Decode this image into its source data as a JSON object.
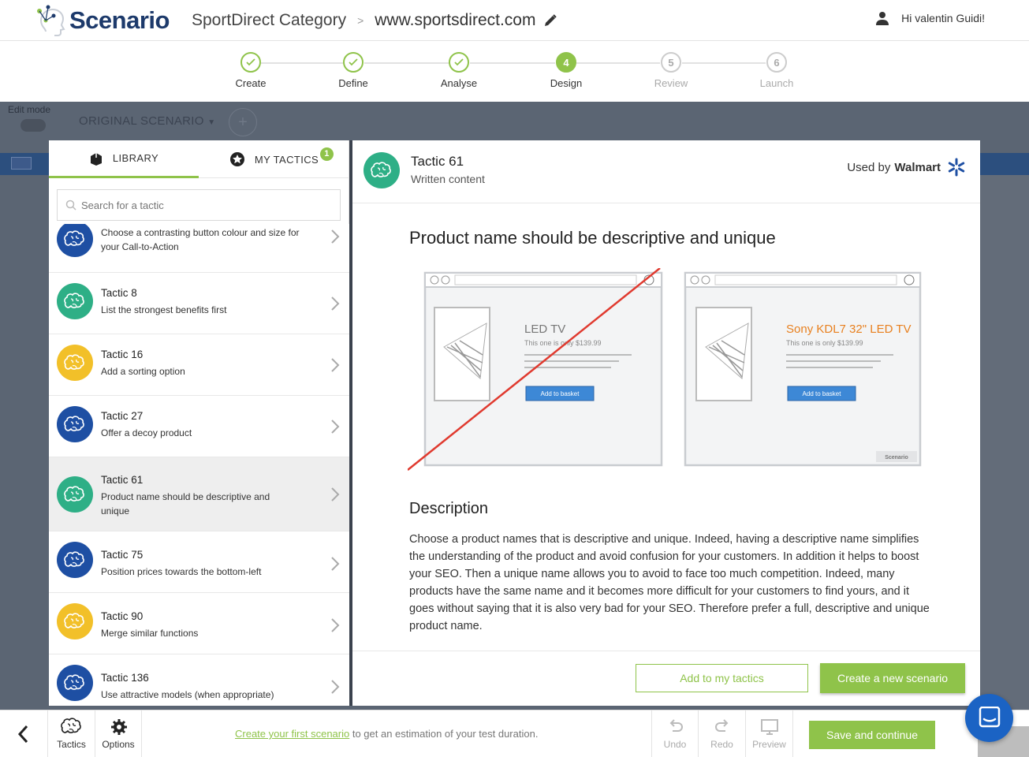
{
  "header": {
    "logo_text": "Scenario",
    "project": "SportDirect Category",
    "separator": ">",
    "url": "www.sportsdirect.com",
    "greeting": "Hi valentin Guidi!"
  },
  "steps": [
    {
      "num": "✓",
      "label": "Create",
      "state": "done"
    },
    {
      "num": "✓",
      "label": "Define",
      "state": "done"
    },
    {
      "num": "✓",
      "label": "Analyse",
      "state": "done"
    },
    {
      "num": "4",
      "label": "Design",
      "state": "active"
    },
    {
      "num": "5",
      "label": "Review",
      "state": "future"
    },
    {
      "num": "6",
      "label": "Launch",
      "state": "future"
    }
  ],
  "background": {
    "edit_mode": "Edit mode",
    "scenario_select": "ORIGINAL SCENARIO",
    "plus": "+"
  },
  "library": {
    "tab_library": "LIBRARY",
    "tab_my_tactics": "MY TACTICS",
    "my_tactics_count": "1",
    "search_placeholder": "Search for a tactic",
    "tactics": [
      {
        "title": "",
        "desc": "Choose a contrasting button colour and size for your Call-to-Action",
        "color": "blue"
      },
      {
        "title": "Tactic 8",
        "desc": "List the strongest benefits first",
        "color": "green"
      },
      {
        "title": "Tactic 16",
        "desc": "Add a sorting option",
        "color": "yellow"
      },
      {
        "title": "Tactic 27",
        "desc": "Offer a decoy product",
        "color": "blue"
      },
      {
        "title": "Tactic 61",
        "desc": "Product name should be descriptive and unique",
        "color": "green"
      },
      {
        "title": "Tactic 75",
        "desc": "Position prices towards the bottom-left",
        "color": "blue"
      },
      {
        "title": "Tactic 90",
        "desc": "Merge similar functions",
        "color": "yellow"
      },
      {
        "title": "Tactic 136",
        "desc": "Use attractive models (when appropriate)",
        "color": "blue"
      }
    ]
  },
  "detail": {
    "title": "Tactic 61",
    "category": "Written content",
    "used_by_prefix": "Used by",
    "used_by_brand": "Walmart",
    "heading": "Product name should be descriptive and unique",
    "illustration": {
      "bad_title": "LED TV",
      "bad_sub": "This one is only $139.99",
      "good_title": "Sony KDL7 32\" LED TV",
      "good_sub": "This one is only $139.99",
      "button": "Add to basket",
      "watermark": "Scenario"
    },
    "desc_heading": "Description",
    "description": "Choose a product names that is descriptive and unique. Indeed, having a descriptive name simplifies the understanding of the product and avoid confusion for your customers. In addition it helps to boost your SEO. Then a unique name allows you to avoid to face too much competition. Indeed, many products have the same name and it becomes more difficult for your customers to find yours, and it goes without saying that it is also very bad for your SEO. Therefore prefer a full, descriptive and unique product name.",
    "add_button": "Add to my tactics",
    "create_button": "Create a new scenario"
  },
  "bottom": {
    "tactics": "Tactics",
    "options": "Options",
    "hint_link": "Create your first scenario",
    "hint_rest": " to get an estimation of your test duration.",
    "undo": "Undo",
    "redo": "Redo",
    "preview": "Preview",
    "save": "Save and continue"
  },
  "colors": {
    "accent": "#8fc34a",
    "brand": "#1d3a6b",
    "blue": "#1e4fa3",
    "green": "#2eaf86",
    "yellow": "#f2c029"
  }
}
